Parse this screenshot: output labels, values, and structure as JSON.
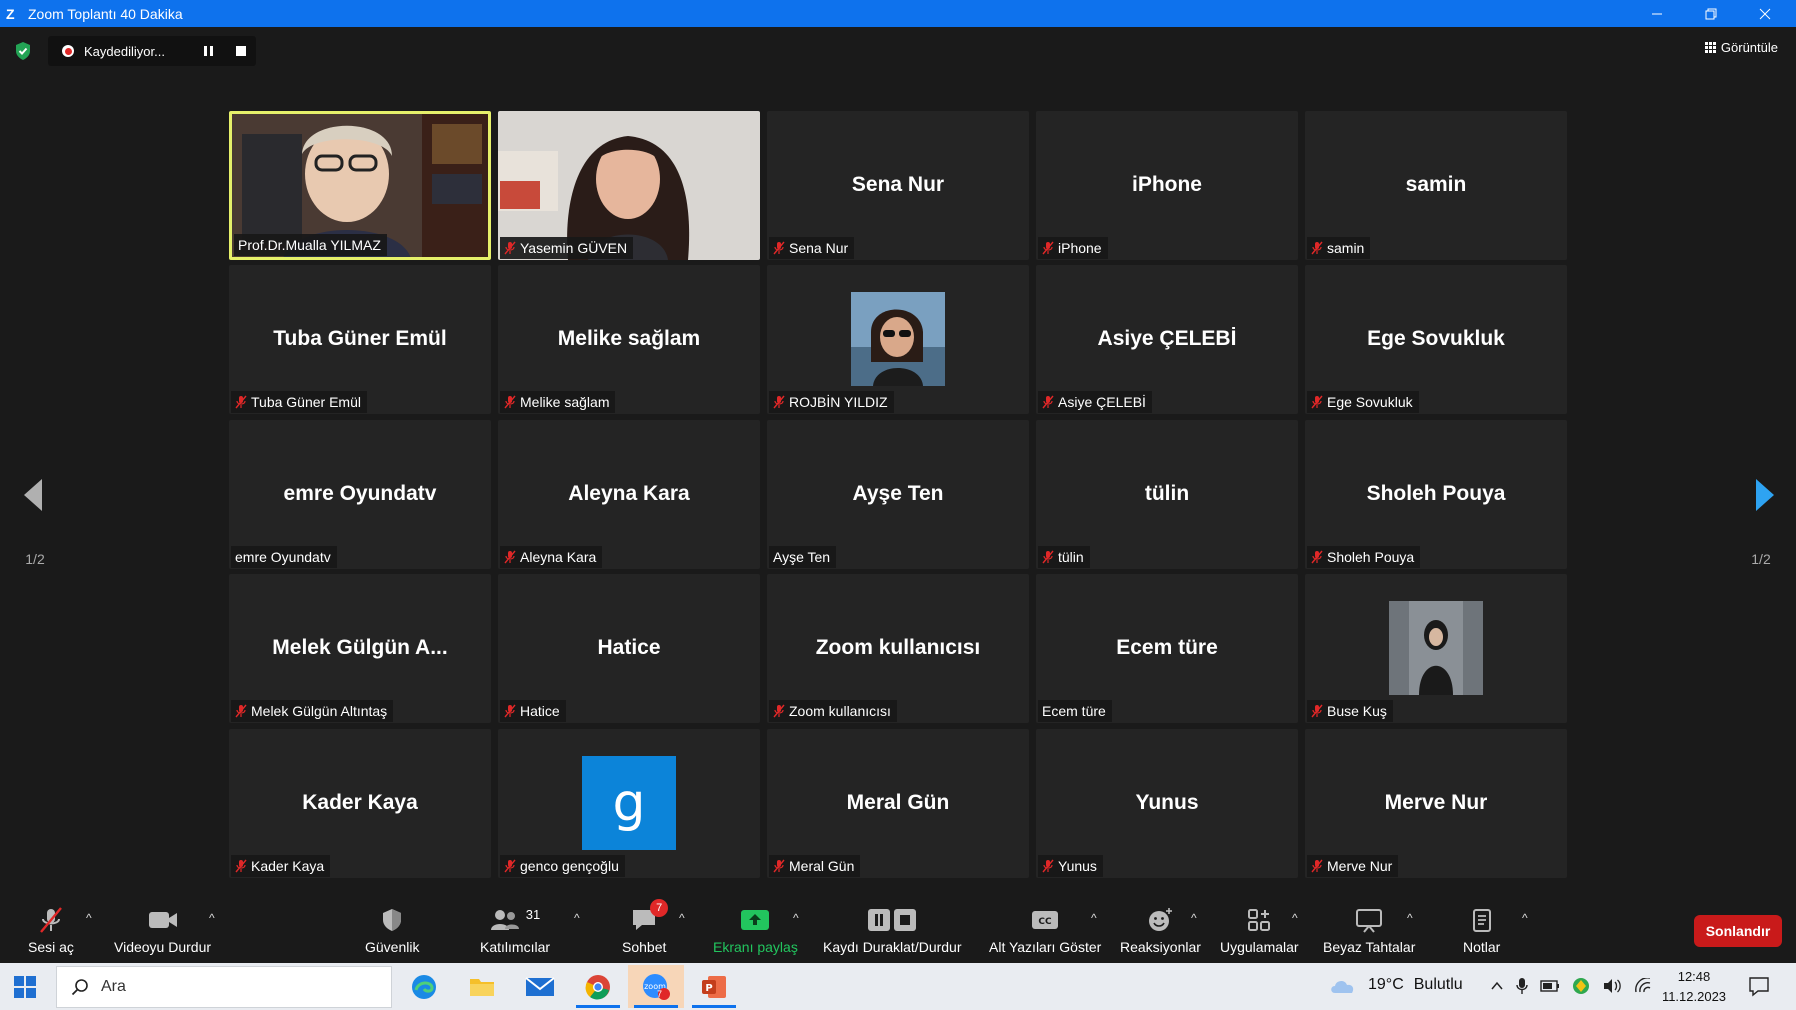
{
  "window": {
    "title": "Zoom Toplantı 40 Dakika"
  },
  "topbar": {
    "recording_status": "Kaydediliyor...",
    "view_label": "Görüntüle"
  },
  "pager": {
    "prev_label": "1/2",
    "next_label": "1/2"
  },
  "participants": [
    {
      "big": "",
      "name": "Prof.Dr.Mualla YILMAZ",
      "muted": false,
      "video": "video",
      "active": true
    },
    {
      "big": "",
      "name": "Yasemin GÜVEN",
      "muted": true,
      "video": "video",
      "active": false
    },
    {
      "big": "Sena Nur",
      "name": "Sena Nur",
      "muted": true,
      "video": "name",
      "active": false
    },
    {
      "big": "iPhone",
      "name": "iPhone",
      "muted": true,
      "video": "name",
      "active": false
    },
    {
      "big": "samin",
      "name": "samin",
      "muted": true,
      "video": "name",
      "active": false
    },
    {
      "big": "Tuba Güner Emül",
      "name": "Tuba Güner Emül",
      "muted": true,
      "video": "name",
      "active": false
    },
    {
      "big": "Melike sağlam",
      "name": "Melike sağlam",
      "muted": true,
      "video": "name",
      "active": false
    },
    {
      "big": "",
      "name": "ROJBİN YILDIZ",
      "muted": true,
      "video": "photo",
      "active": false
    },
    {
      "big": "Asiye ÇELEBİ",
      "name": "Asiye ÇELEBİ",
      "muted": true,
      "video": "name",
      "active": false
    },
    {
      "big": "Ege Sovukluk",
      "name": "Ege Sovukluk",
      "muted": true,
      "video": "name",
      "active": false
    },
    {
      "big": "emre Oyundatv",
      "name": "emre Oyundatv",
      "muted": false,
      "video": "name",
      "active": false
    },
    {
      "big": "Aleyna Kara",
      "name": "Aleyna Kara",
      "muted": true,
      "video": "name",
      "active": false
    },
    {
      "big": "Ayşe Ten",
      "name": "Ayşe Ten",
      "muted": false,
      "video": "name",
      "active": false
    },
    {
      "big": "tülin",
      "name": "tülin",
      "muted": true,
      "video": "name",
      "active": false
    },
    {
      "big": "Sholeh Pouya",
      "name": "Sholeh Pouya",
      "muted": true,
      "video": "name",
      "active": false
    },
    {
      "big": "Melek Gülgün A...",
      "name": "Melek Gülgün Altıntaş",
      "muted": true,
      "video": "name",
      "active": false
    },
    {
      "big": "Hatice",
      "name": "Hatice",
      "muted": true,
      "video": "name",
      "active": false
    },
    {
      "big": "Zoom kullanıcısı",
      "name": "Zoom kullanıcısı",
      "muted": true,
      "video": "name",
      "active": false
    },
    {
      "big": "Ecem türe",
      "name": "Ecem türe",
      "muted": false,
      "video": "name",
      "active": false
    },
    {
      "big": "",
      "name": "Buse Kuş",
      "muted": true,
      "video": "photo",
      "active": false
    },
    {
      "big": "Kader Kaya",
      "name": "Kader Kaya",
      "muted": true,
      "video": "name",
      "active": false
    },
    {
      "big": "",
      "name": "genco gençoğlu",
      "muted": true,
      "video": "initial",
      "initial": "g",
      "active": false
    },
    {
      "big": "Meral Gün",
      "name": "Meral Gün",
      "muted": true,
      "video": "name",
      "active": false
    },
    {
      "big": "Yunus",
      "name": "Yunus",
      "muted": true,
      "video": "name",
      "active": false
    },
    {
      "big": "Merve Nur",
      "name": "Merve Nur",
      "muted": true,
      "video": "name",
      "active": false
    }
  ],
  "toolbar": {
    "unmute": "Sesi aç",
    "stop_video": "Videoyu Durdur",
    "security": "Güvenlik",
    "participants": "Katılımcılar",
    "participants_count": "31",
    "chat": "Sohbet",
    "chat_badge": "7",
    "share": "Ekranı paylaş",
    "record": "Kaydı Duraklat/Durdur",
    "captions": "Alt Yazıları Göster",
    "reactions": "Reaksiyonlar",
    "apps": "Uygulamalar",
    "whiteboards": "Beyaz Tahtalar",
    "notes": "Notlar",
    "end": "Sonlandır"
  },
  "taskbar": {
    "search_placeholder": "Ara",
    "zoom_badge": "7",
    "weather_temp": "19°C",
    "weather_desc": "Bulutlu",
    "time": "12:48",
    "date": "11.12.2023"
  },
  "colors": {
    "accent": "#0e72ed",
    "active_speaker": "#e6f06a",
    "end_button": "#c91a1a",
    "share_green": "#22c55e",
    "muted_red": "#e02828"
  }
}
